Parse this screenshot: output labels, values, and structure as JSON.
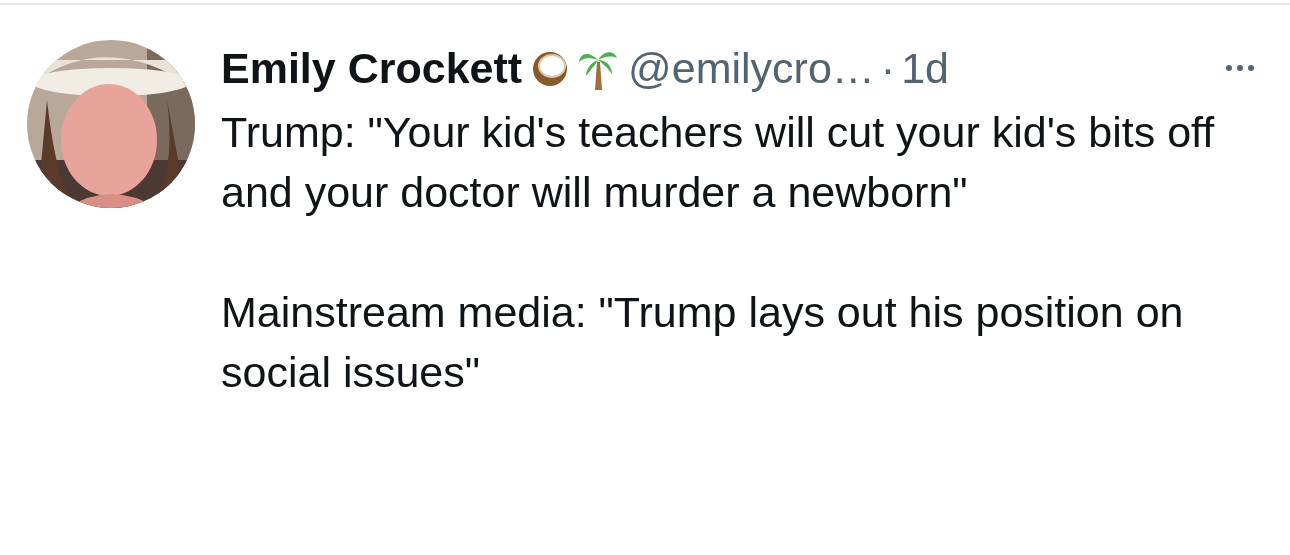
{
  "tweet": {
    "author": {
      "name": "Emily Crockett",
      "handle": "@emilycro…",
      "separator": "·",
      "time": "1d"
    },
    "paragraphs": [
      "Trump: \"Your kid's teachers will cut your kid's bits off and your doctor will murder a newborn\"",
      "Mainstream media: \"Trump lays out his position on social issues\""
    ]
  }
}
